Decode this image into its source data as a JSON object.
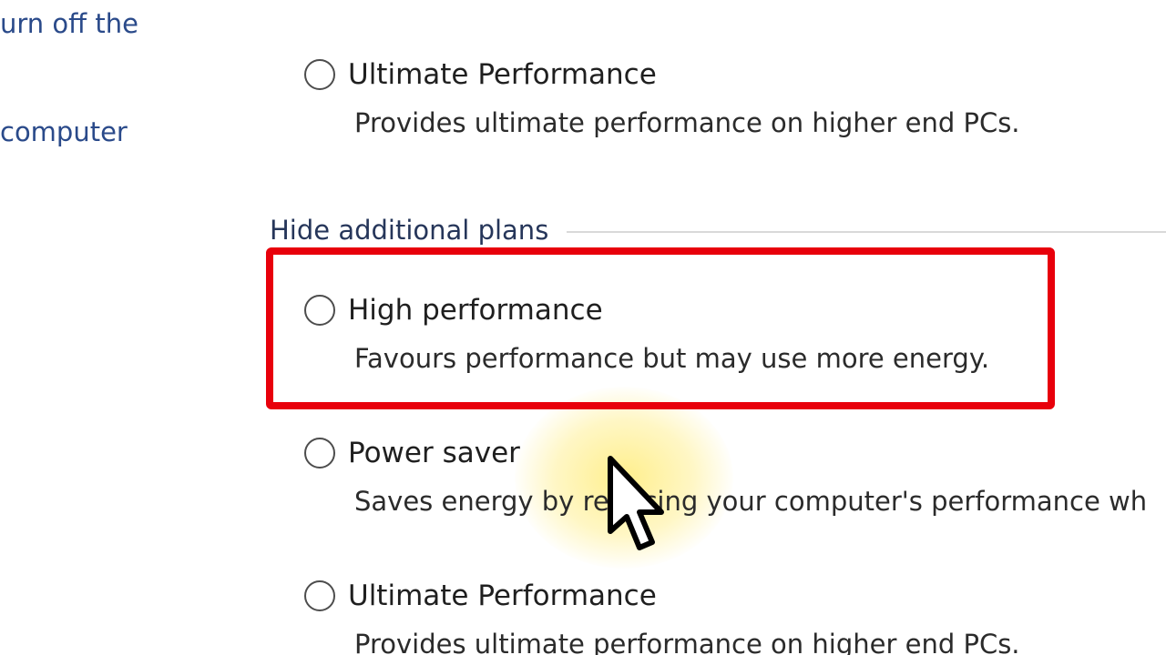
{
  "left_panel": {
    "link_fragment_1": "urn off the",
    "link_fragment_2": " computer"
  },
  "plans_top": [
    {
      "name": "Ultimate Performance",
      "description": "Provides ultimate performance on higher end PCs.",
      "selected": false
    }
  ],
  "additional_plans": {
    "toggle_label": "Hide additional plans",
    "plans": [
      {
        "name": "High performance",
        "description": "Favours performance but may use more energy.",
        "selected": false
      },
      {
        "name": "Power saver",
        "description": "Saves energy by reducing your computer's performance wh",
        "selected": false
      },
      {
        "name": "Ultimate Performance",
        "description": "Provides ultimate performance on higher end PCs.",
        "selected": false
      }
    ]
  },
  "annotation": {
    "highlight_color": "#e8000b",
    "cursor_glow_color": "#ffec78"
  }
}
